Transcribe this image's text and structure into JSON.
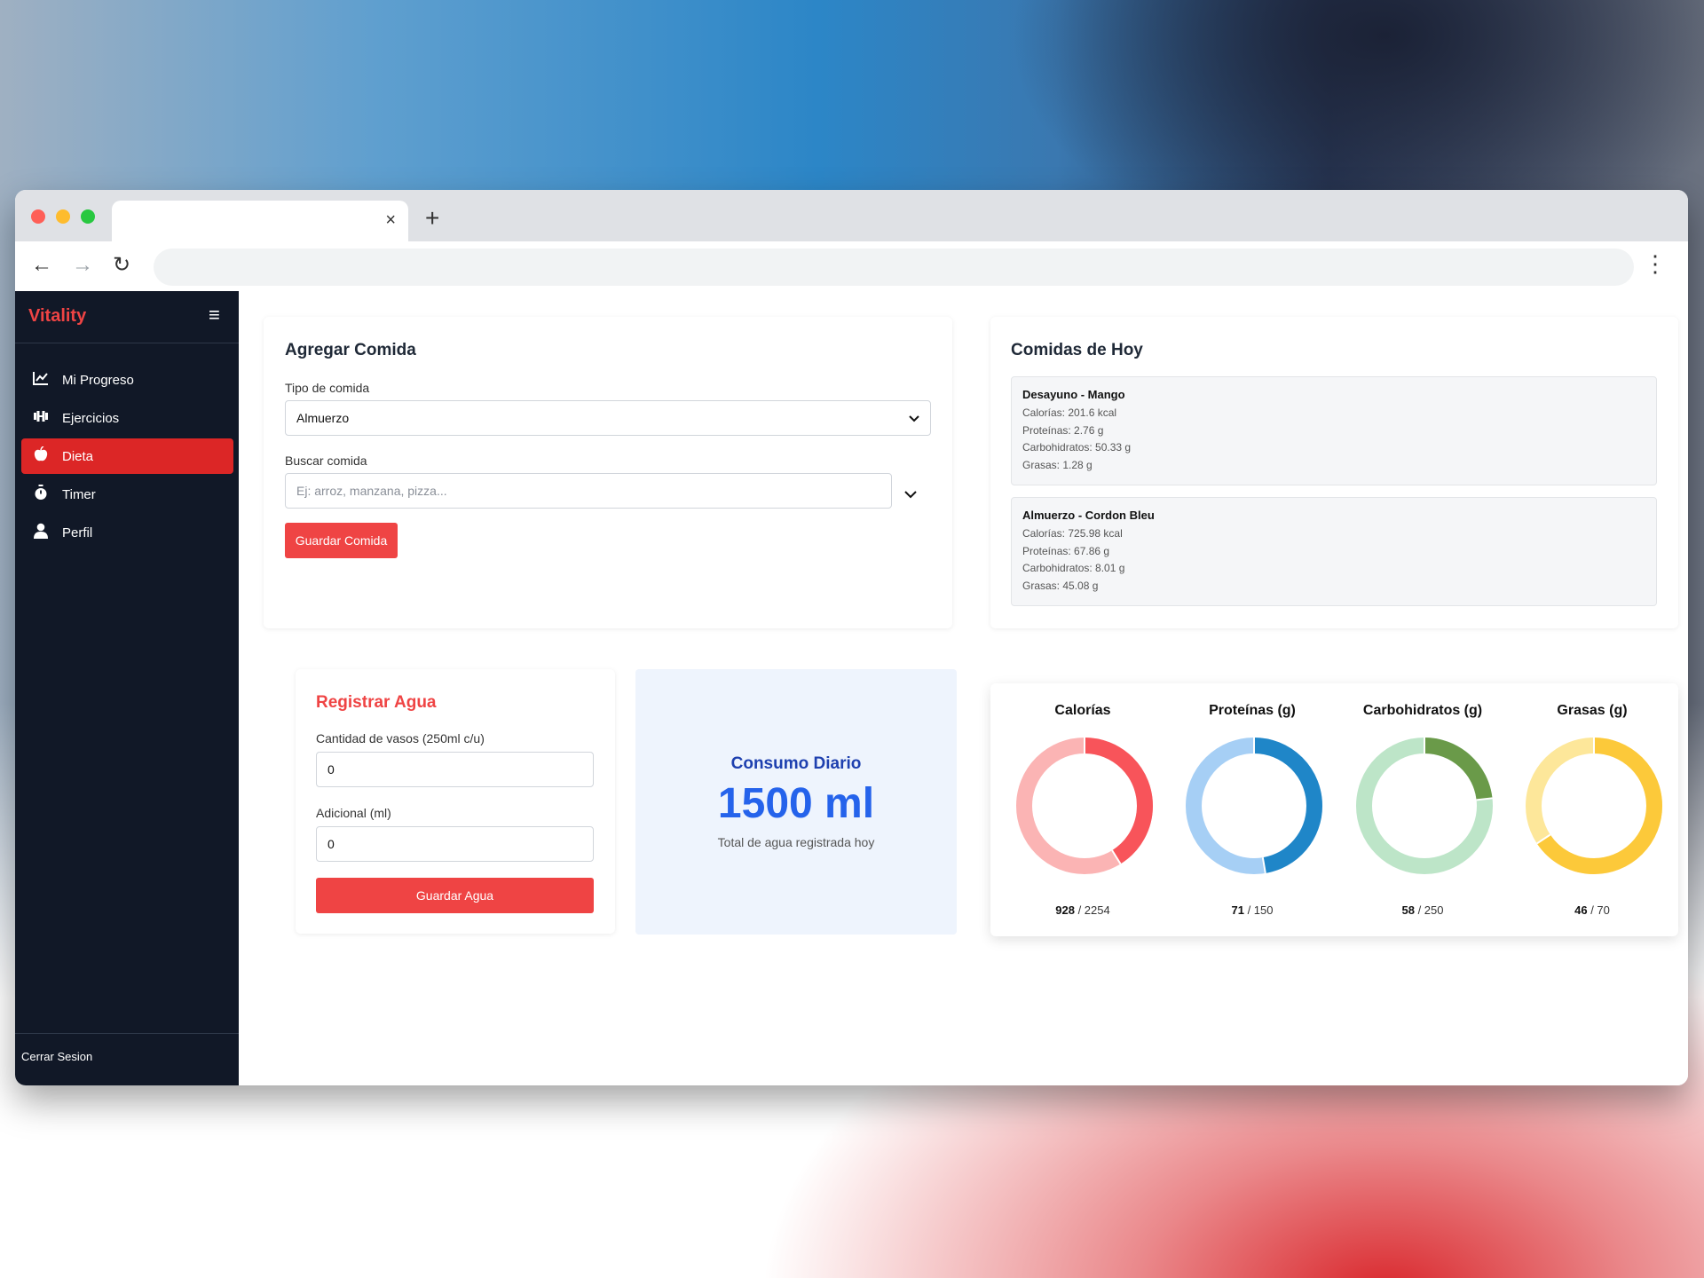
{
  "browser": {
    "tab_close": "×",
    "new_tab": "+",
    "back": "←",
    "forward": "→",
    "reload": "↻",
    "menu": "⋮"
  },
  "sidebar": {
    "brand": "Vitality",
    "items": [
      {
        "label": "Mi Progreso",
        "icon": "chart-line-icon",
        "glyph": "📈"
      },
      {
        "label": "Ejercicios",
        "icon": "dumbbell-icon",
        "glyph": "⊞"
      },
      {
        "label": "Dieta",
        "icon": "apple-icon",
        "glyph": "●",
        "active": true
      },
      {
        "label": "Timer",
        "icon": "stopwatch-icon",
        "glyph": "⏱"
      },
      {
        "label": "Perfil",
        "icon": "user-icon",
        "glyph": "👤"
      }
    ],
    "logout": "Cerrar Sesion"
  },
  "add_meal": {
    "title": "Agregar Comida",
    "type_label": "Tipo de comida",
    "type_value": "Almuerzo",
    "search_label": "Buscar comida",
    "search_placeholder": "Ej: arroz, manzana, pizza...",
    "save_button": "Guardar Comida"
  },
  "today_meals": {
    "title": "Comidas de Hoy",
    "meals": [
      {
        "name": "Desayuno - Mango",
        "calories": "Calorías: 201.6 kcal",
        "protein": "Proteínas: 2.76 g",
        "carbs": "Carbohidratos: 50.33 g",
        "fat": "Grasas: 1.28 g"
      },
      {
        "name": "Almuerzo - Cordon Bleu",
        "calories": "Calorías: 725.98 kcal",
        "protein": "Proteínas: 67.86 g",
        "carbs": "Carbohidratos: 8.01 g",
        "fat": "Grasas: 45.08 g"
      }
    ]
  },
  "water": {
    "title": "Registrar Agua",
    "glasses_label": "Cantidad de vasos (250ml c/u)",
    "glasses_value": "0",
    "extra_label": "Adicional (ml)",
    "extra_value": "0",
    "save_button": "Guardar Agua"
  },
  "daily": {
    "title": "Consumo Diario",
    "amount": "1500 ml",
    "subtitle": "Total de agua registrada hoy"
  },
  "macros": [
    {
      "title": "Calorías",
      "consumed": "928",
      "goal": "/ 2254",
      "consumed_num": 928,
      "goal_num": 2254,
      "color": "#f8545a",
      "track": "#fbb4b4"
    },
    {
      "title": "Proteínas (g)",
      "consumed": "71",
      "goal": "/ 150",
      "consumed_num": 71,
      "goal_num": 150,
      "color": "#1f86c8",
      "track": "#a6cff5"
    },
    {
      "title": "Carbohidratos (g)",
      "consumed": "58",
      "goal": "/ 250",
      "consumed_num": 58,
      "goal_num": 250,
      "color": "#6a9a49",
      "track": "#bde5c8"
    },
    {
      "title": "Grasas (g)",
      "consumed": "46",
      "goal": "/ 70",
      "consumed_num": 46,
      "goal_num": 70,
      "color": "#fcc93a",
      "track": "#fde79a"
    }
  ]
}
